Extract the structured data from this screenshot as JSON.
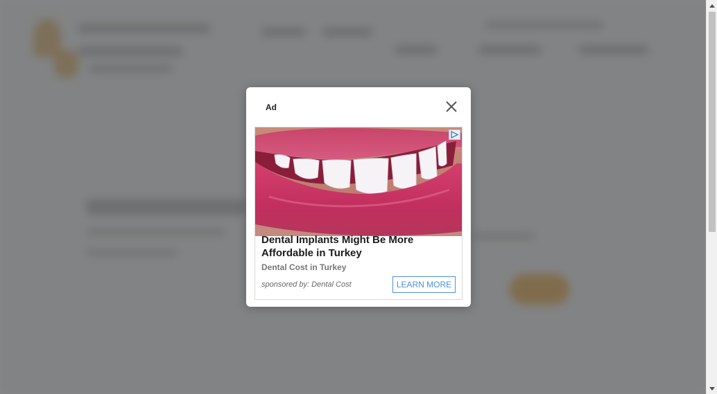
{
  "modal": {
    "ad_label": "Ad",
    "close_icon": "close-icon"
  },
  "ad": {
    "title": "Dental Implants Might Be More Affordable in Turkey",
    "source": "Dental Cost in Turkey",
    "sponsor": "sponsored by: Dental Cost",
    "cta_label": "LEARN MORE",
    "adchoices_icon": "adchoices-icon",
    "image_subject": "smile-teeth-image"
  },
  "colors": {
    "overlay": "#505254",
    "cta_accent": "#4a90d9",
    "background_button": "#f2a93b"
  }
}
